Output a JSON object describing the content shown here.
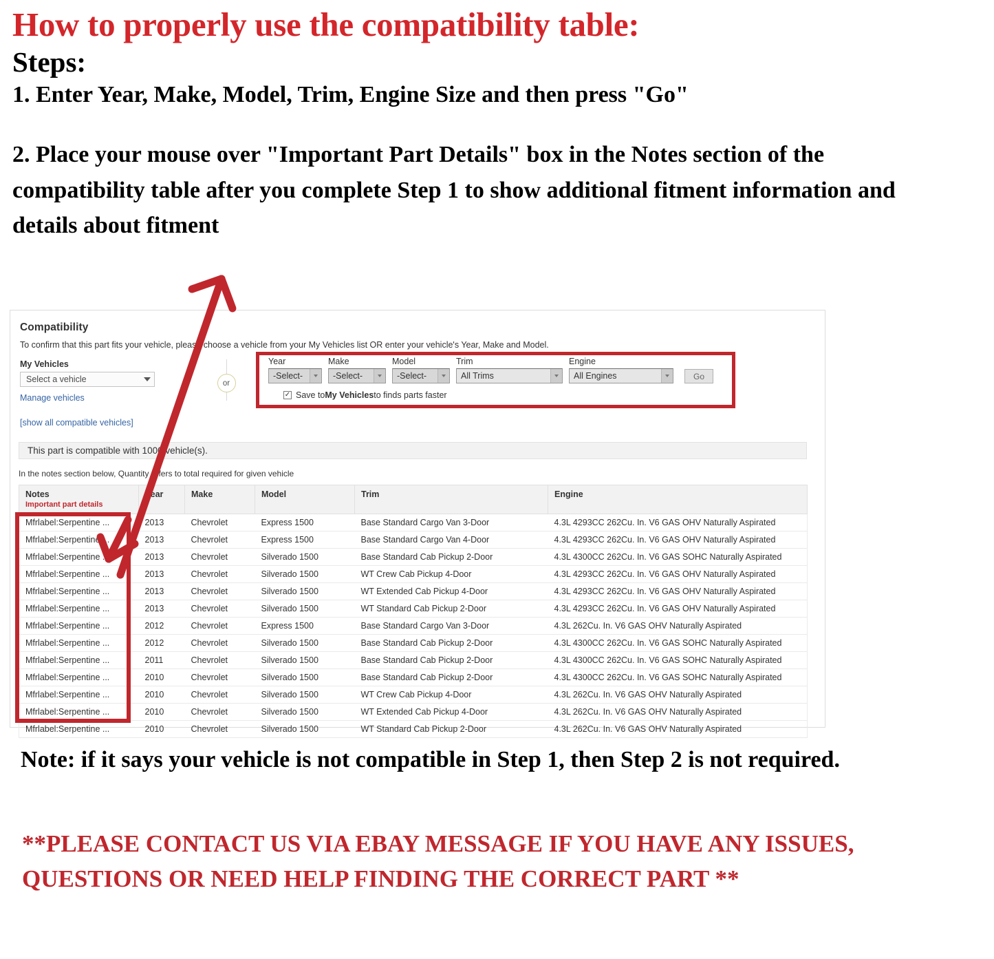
{
  "headline": "How to properly use the compatibility table:",
  "steps_label": "Steps:",
  "step_one": "1. Enter Year, Make, Model, Trim, Engine Size and then press \"Go\"",
  "step_two": "2. Place your mouse over \"Important Part Details\" box in the Notes section of the compatibility table after you complete Step 1 to show additional fitment information and details about fitment",
  "note": "Note: if it says your vehicle is not compatible in Step 1, then Step 2 is not required.",
  "contact": "**PLEASE CONTACT US VIA EBAY MESSAGE IF YOU HAVE ANY ISSUES, QUESTIONS OR NEED HELP FINDING THE CORRECT PART **",
  "colors": {
    "accent_red": "#d3262b",
    "highlight_red": "#c0272d",
    "link_blue": "#3665a5",
    "header_gray": "#f2f2f2"
  },
  "compat": {
    "title": "Compatibility",
    "subtitle": "To confirm that this part fits your vehicle, please choose a vehicle from your My Vehicles list OR enter your vehicle's Year, Make and Model.",
    "my_vehicles_label": "My Vehicles",
    "my_vehicles_value": "Select a vehicle",
    "manage_vehicles_link": "Manage vehicles",
    "show_all_link": "[show all compatible vehicles]",
    "or_label": "or",
    "banner": "This part is compatible with 1000 vehicle(s).",
    "notes_hint": "In the notes section below, Quantity refers to total required for given vehicle",
    "search": {
      "fields": [
        {
          "label": "Year",
          "value": "-Select-"
        },
        {
          "label": "Make",
          "value": "-Select-"
        },
        {
          "label": "Model",
          "value": "-Select-"
        },
        {
          "label": "Trim",
          "value": "All Trims"
        },
        {
          "label": "Engine",
          "value": "All Engines"
        }
      ],
      "go_label": "Go",
      "save_prefix": "Save to ",
      "save_bold": "My Vehicles",
      "save_suffix": " to finds parts faster",
      "save_checked": true,
      "checkmark": "✓"
    }
  },
  "table": {
    "headers": {
      "notes": "Notes",
      "notes_sub": "Important part details",
      "year": "Year",
      "make": "Make",
      "model": "Model",
      "trim": "Trim",
      "engine": "Engine"
    },
    "rows": [
      {
        "notes": "Mfrlabel:Serpentine ...",
        "year": "2013",
        "make": "Chevrolet",
        "model": "Express 1500",
        "trim": "Base Standard Cargo Van 3-Door",
        "engine": "4.3L 4293CC 262Cu. In. V6 GAS OHV Naturally Aspirated"
      },
      {
        "notes": "Mfrlabel:Serpentine ...",
        "year": "2013",
        "make": "Chevrolet",
        "model": "Express 1500",
        "trim": "Base Standard Cargo Van 4-Door",
        "engine": "4.3L 4293CC 262Cu. In. V6 GAS OHV Naturally Aspirated"
      },
      {
        "notes": "Mfrlabel:Serpentine ...",
        "year": "2013",
        "make": "Chevrolet",
        "model": "Silverado 1500",
        "trim": "Base Standard Cab Pickup 2-Door",
        "engine": "4.3L 4300CC 262Cu. In. V6 GAS SOHC Naturally Aspirated"
      },
      {
        "notes": "Mfrlabel:Serpentine ...",
        "year": "2013",
        "make": "Chevrolet",
        "model": "Silverado 1500",
        "trim": "WT Crew Cab Pickup 4-Door",
        "engine": "4.3L 4293CC 262Cu. In. V6 GAS OHV Naturally Aspirated"
      },
      {
        "notes": "Mfrlabel:Serpentine ...",
        "year": "2013",
        "make": "Chevrolet",
        "model": "Silverado 1500",
        "trim": "WT Extended Cab Pickup 4-Door",
        "engine": "4.3L 4293CC 262Cu. In. V6 GAS OHV Naturally Aspirated"
      },
      {
        "notes": "Mfrlabel:Serpentine ...",
        "year": "2013",
        "make": "Chevrolet",
        "model": "Silverado 1500",
        "trim": "WT Standard Cab Pickup 2-Door",
        "engine": "4.3L 4293CC 262Cu. In. V6 GAS OHV Naturally Aspirated"
      },
      {
        "notes": "Mfrlabel:Serpentine ...",
        "year": "2012",
        "make": "Chevrolet",
        "model": "Express 1500",
        "trim": "Base Standard Cargo Van 3-Door",
        "engine": "4.3L 262Cu. In. V6 GAS OHV Naturally Aspirated"
      },
      {
        "notes": "Mfrlabel:Serpentine ...",
        "year": "2012",
        "make": "Chevrolet",
        "model": "Silverado 1500",
        "trim": "Base Standard Cab Pickup 2-Door",
        "engine": "4.3L 4300CC 262Cu. In. V6 GAS SOHC Naturally Aspirated"
      },
      {
        "notes": "Mfrlabel:Serpentine ...",
        "year": "2011",
        "make": "Chevrolet",
        "model": "Silverado 1500",
        "trim": "Base Standard Cab Pickup 2-Door",
        "engine": "4.3L 4300CC 262Cu. In. V6 GAS SOHC Naturally Aspirated"
      },
      {
        "notes": "Mfrlabel:Serpentine ...",
        "year": "2010",
        "make": "Chevrolet",
        "model": "Silverado 1500",
        "trim": "Base Standard Cab Pickup 2-Door",
        "engine": "4.3L 4300CC 262Cu. In. V6 GAS SOHC Naturally Aspirated"
      },
      {
        "notes": "Mfrlabel:Serpentine ...",
        "year": "2010",
        "make": "Chevrolet",
        "model": "Silverado 1500",
        "trim": "WT Crew Cab Pickup 4-Door",
        "engine": "4.3L 262Cu. In. V6 GAS OHV Naturally Aspirated"
      },
      {
        "notes": "Mfrlabel:Serpentine ...",
        "year": "2010",
        "make": "Chevrolet",
        "model": "Silverado 1500",
        "trim": "WT Extended Cab Pickup 4-Door",
        "engine": "4.3L 262Cu. In. V6 GAS OHV Naturally Aspirated"
      },
      {
        "notes": "Mfrlabel:Serpentine ...",
        "year": "2010",
        "make": "Chevrolet",
        "model": "Silverado 1500",
        "trim": "WT Standard Cab Pickup 2-Door",
        "engine": "4.3L 262Cu. In. V6 GAS OHV Naturally Aspirated"
      }
    ]
  }
}
